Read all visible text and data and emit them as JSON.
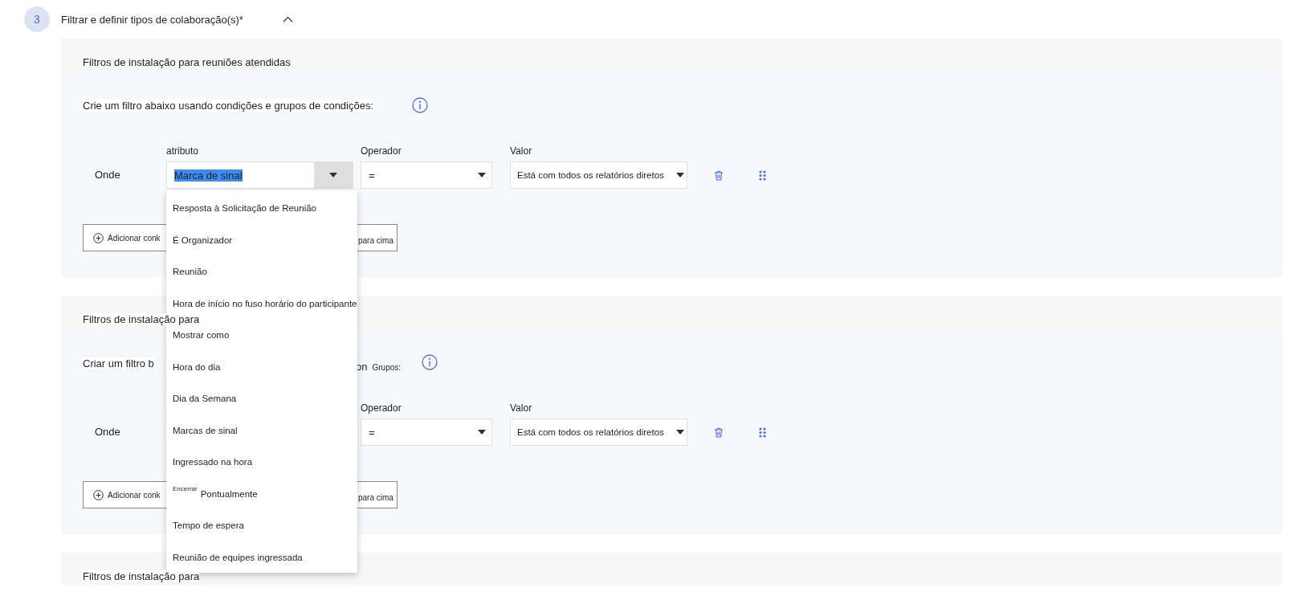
{
  "step": {
    "number": "3",
    "title": "Filtrar e definir tipos de colaboração(s)*",
    "expanded": true
  },
  "sections": [
    {
      "header": "Filtros de instalação para reuniões atendidas",
      "instruction": [
        {
          "kind": "text",
          "text": "Crie um filtro abaixo usando condições e grupos de condições:"
        }
      ],
      "condition": {
        "where": "Onde",
        "attribute": {
          "label": "atributo",
          "value": "Marca de sinal",
          "text_selected": true
        },
        "operator": {
          "label": "Operador",
          "value": "="
        },
        "value": {
          "label": "Valor",
          "value": "Está com todos os relatórios diretos"
        }
      },
      "add_button": {
        "left": "Adicionar conk",
        "right": "para cima"
      }
    },
    {
      "header": "Filtros de instalação para",
      "instruction": [
        {
          "kind": "text",
          "text": "Criar um filtro b"
        },
        {
          "kind": "text",
          "text": "on"
        },
        {
          "kind": "small",
          "text": "Grupos:"
        }
      ],
      "condition": {
        "where": "Onde",
        "operator": {
          "label": "Operador",
          "value": "="
        },
        "value": {
          "label": "Valor",
          "value": "Está com todos os relatórios diretos"
        }
      },
      "add_button": {
        "left": "Adicionar conk",
        "right": "para cima"
      }
    },
    {
      "header": "Filtros de instalação para"
    }
  ],
  "dropdown": {
    "items": [
      {
        "label": "Resposta à Solicitação de Reunião",
        "selected": false
      },
      {
        "label": "É Organizador",
        "selected": false
      },
      {
        "label": "Reunião",
        "selected": false
      },
      {
        "label": "Hora de início no fuso horário do participante",
        "selected": false
      },
      {
        "label": "Mostrar como",
        "selected": false
      },
      {
        "label": "Hora do dia",
        "selected": false
      },
      {
        "label": "Dia da Semana",
        "selected": false
      },
      {
        "label": "Marcas de sinal",
        "selected": false
      },
      {
        "label": "Ingressado na hora",
        "selected": false
      },
      {
        "label": "Pontualmente",
        "note": "Encerrar",
        "selected": false
      },
      {
        "label": "Tempo de espera",
        "selected": false
      },
      {
        "label": "Reunião de equipes ingressada",
        "selected": false
      }
    ]
  }
}
